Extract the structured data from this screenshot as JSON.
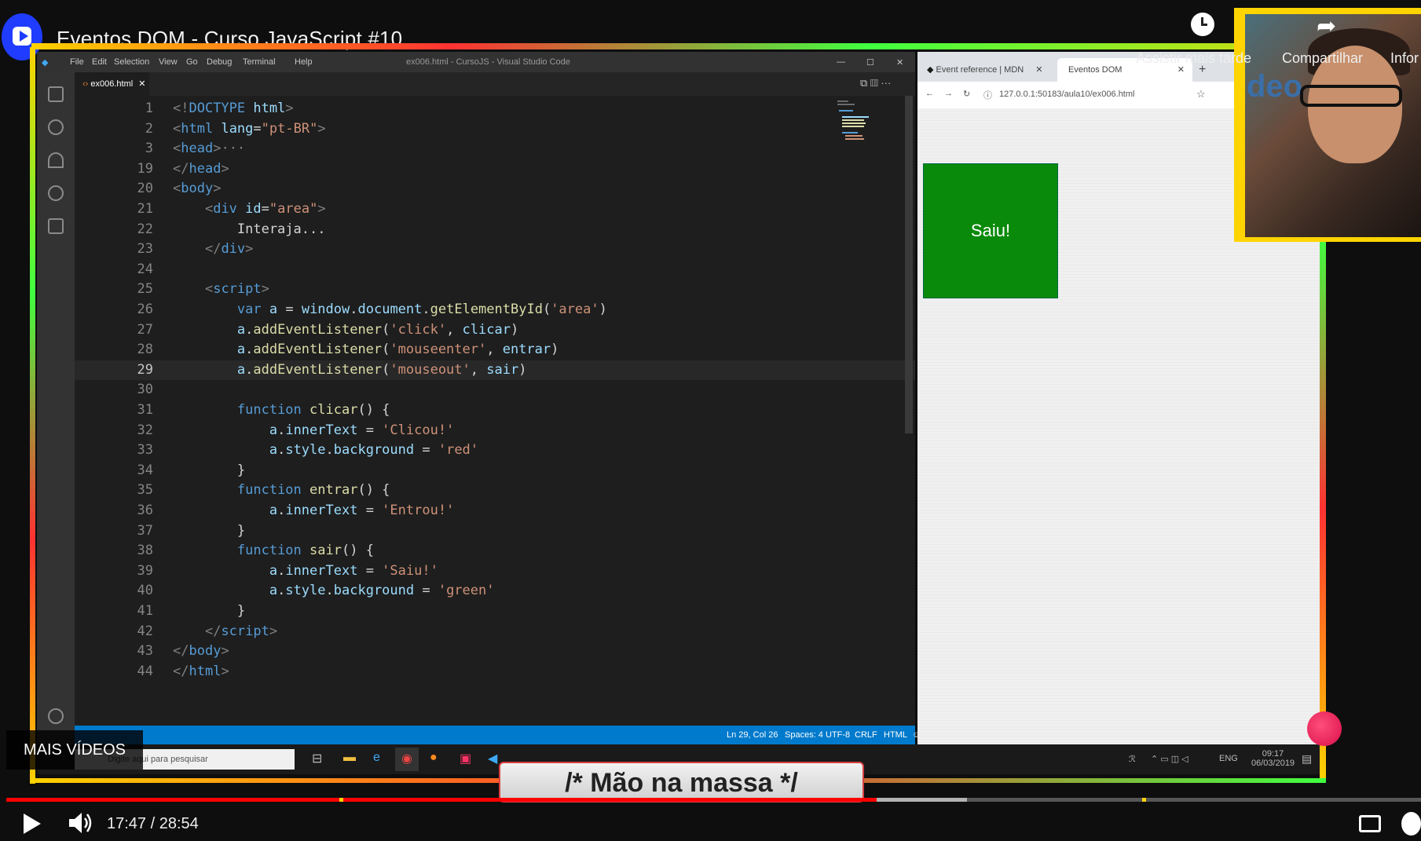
{
  "player": {
    "title": "Eventos DOM - Curso JavaScript #10",
    "actions": {
      "watch_later": "Assistir mais tarde",
      "share": "Compartilhar",
      "info": "Infor"
    },
    "time": "17:47 / 28:54",
    "more_videos": "MAIS VÍDEOS",
    "progress_fraction": 0.615,
    "buffer_fraction": 0.679
  },
  "banner": {
    "text": "/* Mão na massa */"
  },
  "vscode": {
    "menu": [
      "File",
      "Edit",
      "Selection",
      "View",
      "Go",
      "Debug",
      "Terminal",
      "Help"
    ],
    "window_title": "ex006.html - CursoJS - Visual Studio Code",
    "tab": "ex006.html",
    "active_line": "29",
    "lines": [
      {
        "n": "1",
        "html": "<span class=\"t\">&lt;!</span><span class=\"tg\">DOCTYPE</span> <span class=\"at\">html</span><span class=\"t\">&gt;</span>"
      },
      {
        "n": "2",
        "html": "<span class=\"t\">&lt;</span><span class=\"tg\">html</span> <span class=\"at\">lang</span>=<span class=\"st\">\"pt-BR\"</span><span class=\"t\">&gt;</span>"
      },
      {
        "n": "3",
        "html": "<span class=\"t\">&lt;</span><span class=\"tg\">head</span><span class=\"t\">&gt;</span><span class=\"t\">···</span>"
      },
      {
        "n": "19",
        "html": "<span class=\"t\">&lt;/</span><span class=\"tg\">head</span><span class=\"t\">&gt;</span>"
      },
      {
        "n": "20",
        "html": "<span class=\"t\">&lt;</span><span class=\"tg\">body</span><span class=\"t\">&gt;</span>"
      },
      {
        "n": "21",
        "html": "    <span class=\"t\">&lt;</span><span class=\"tg\">div</span> <span class=\"at\">id</span>=<span class=\"st\">\"area\"</span><span class=\"t\">&gt;</span>"
      },
      {
        "n": "22",
        "html": "        Interaja..."
      },
      {
        "n": "23",
        "html": "    <span class=\"t\">&lt;/</span><span class=\"tg\">div</span><span class=\"t\">&gt;</span>"
      },
      {
        "n": "24",
        "html": ""
      },
      {
        "n": "25",
        "html": "    <span class=\"t\">&lt;</span><span class=\"tg\">script</span><span class=\"t\">&gt;</span>"
      },
      {
        "n": "26",
        "html": "        <span class=\"kw\">var</span> <span class=\"vr\">a</span> = <span class=\"vr\">window</span>.<span class=\"vr\">document</span>.<span class=\"fn\">getElementById</span>(<span class=\"st\">'area'</span>)"
      },
      {
        "n": "27",
        "html": "        <span class=\"vr\">a</span>.<span class=\"fn\">addEventListener</span>(<span class=\"st\">'click'</span>, <span class=\"vr\">clicar</span>)"
      },
      {
        "n": "28",
        "html": "        <span class=\"vr\">a</span>.<span class=\"fn\">addEventListener</span>(<span class=\"st\">'mouseenter'</span>, <span class=\"vr\">entrar</span>)"
      },
      {
        "n": "29",
        "html": "        <span class=\"vr\">a</span>.<span class=\"fn\">addEventListener</span>(<span class=\"st\">'mouseout'</span>, <span class=\"vr\">sair</span>)"
      },
      {
        "n": "30",
        "html": ""
      },
      {
        "n": "31",
        "html": "        <span class=\"kw\">function</span> <span class=\"fn\">clicar</span>() {"
      },
      {
        "n": "32",
        "html": "            <span class=\"vr\">a</span>.<span class=\"vr\">innerText</span> = <span class=\"st\">'Clicou!'</span>"
      },
      {
        "n": "33",
        "html": "            <span class=\"vr\">a</span>.<span class=\"vr\">style</span>.<span class=\"vr\">background</span> = <span class=\"st\">'red'</span>"
      },
      {
        "n": "34",
        "html": "        }"
      },
      {
        "n": "35",
        "html": "        <span class=\"kw\">function</span> <span class=\"fn\">entrar</span>() {"
      },
      {
        "n": "36",
        "html": "            <span class=\"vr\">a</span>.<span class=\"vr\">innerText</span> = <span class=\"st\">'Entrou!'</span>"
      },
      {
        "n": "37",
        "html": "        }"
      },
      {
        "n": "38",
        "html": "        <span class=\"kw\">function</span> <span class=\"fn\">sair</span>() {"
      },
      {
        "n": "39",
        "html": "            <span class=\"vr\">a</span>.<span class=\"vr\">innerText</span> = <span class=\"st\">'Saiu!'</span>"
      },
      {
        "n": "40",
        "html": "            <span class=\"vr\">a</span>.<span class=\"vr\">style</span>.<span class=\"vr\">background</span> = <span class=\"st\">'green'</span>"
      },
      {
        "n": "41",
        "html": "        }"
      },
      {
        "n": "42",
        "html": "    <span class=\"t\">&lt;/</span><span class=\"tg\">script</span><span class=\"t\">&gt;</span>"
      },
      {
        "n": "43",
        "html": "<span class=\"t\">&lt;/</span><span class=\"tg\">body</span><span class=\"t\">&gt;</span>"
      },
      {
        "n": "44",
        "html": "<span class=\"t\">&lt;/</span><span class=\"tg\">html</span><span class=\"t\">&gt;</span>"
      }
    ],
    "status": {
      "position": "Ln 29, Col 26",
      "spaces": "Spaces: 4",
      "encoding": "UTF-8",
      "eol": "CRLF",
      "language": "HTML"
    }
  },
  "browser": {
    "tabs": [
      "Event reference | MDN",
      "Eventos DOM"
    ],
    "url": "127.0.0.1:50183/aula10/ex006.html",
    "area_text": "Saiu!",
    "area_color": "#0a8a0a"
  },
  "taskbar": {
    "search_placeholder": "Digite aqui para pesquisar",
    "lang": "ENG",
    "time": "09:17",
    "date": "06/03/2019"
  },
  "webcam": {
    "visible_text": "deo"
  }
}
